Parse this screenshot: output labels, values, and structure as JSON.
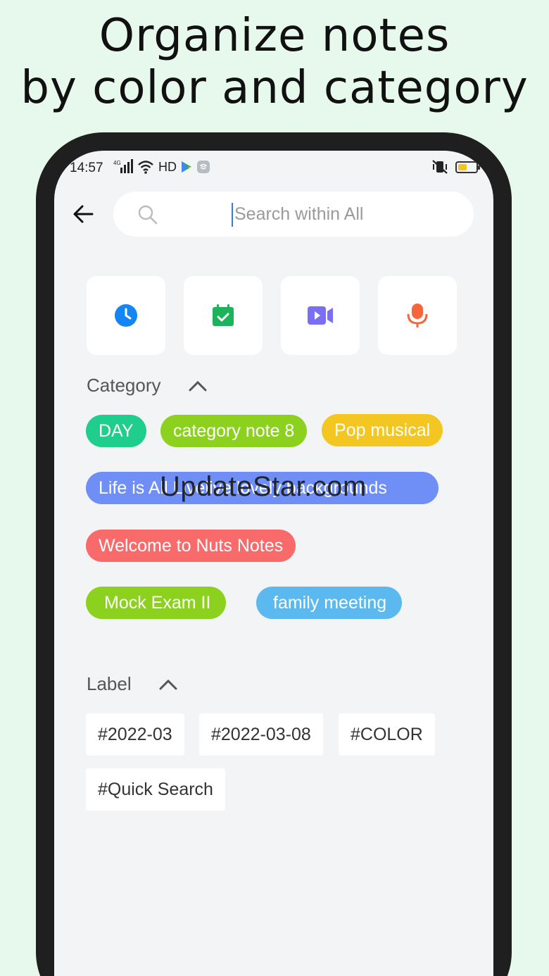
{
  "headline": [
    "Organize notes",
    "by color and category"
  ],
  "status": {
    "time": "14:57",
    "network": "4G",
    "hd": "HD"
  },
  "search": {
    "placeholder": "Search within All"
  },
  "quick_actions": [
    "clock-icon",
    "calendar-check-icon",
    "video-icon",
    "microphone-icon"
  ],
  "colors": {
    "clock": "#1485f5",
    "calendar": "#1db35a",
    "video": "#7b6ef6",
    "mic": "#f5673a"
  },
  "category": {
    "title": "Category",
    "chips": [
      {
        "label": "DAY",
        "color": "#1fcd8c"
      },
      {
        "label": "category note 8",
        "color": "#8dd11f"
      },
      {
        "label": "Pop musical",
        "color": "#f3c621"
      },
      {
        "label": "Life is All Livelive lovely backgrounds",
        "color": "#6f8ff7"
      },
      {
        "label": "Welcome to Nuts Notes",
        "color": "#f96b6b"
      },
      {
        "label": "Mock Exam II",
        "color": "#8dd11f"
      },
      {
        "label": "family meeting",
        "color": "#5bb9ef"
      }
    ]
  },
  "label": {
    "title": "Label",
    "chips": [
      "#2022-03",
      "#2022-03-08",
      "#COLOR",
      "#Quick Search"
    ]
  },
  "watermark": "UpdateStar.com"
}
